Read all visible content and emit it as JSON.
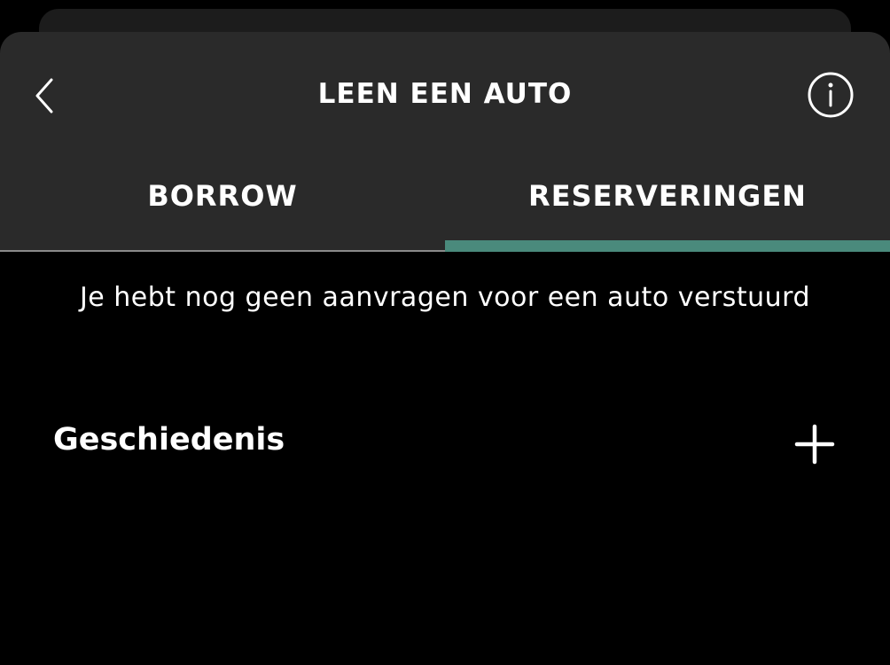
{
  "header": {
    "title": "LEEN EEN AUTO",
    "back_icon": "chevron-left-icon",
    "info_icon": "info-icon"
  },
  "tabs": [
    {
      "label": "BORROW",
      "active": false
    },
    {
      "label": "RESERVERINGEN",
      "active": true
    }
  ],
  "empty_state": {
    "message": "Je hebt nog geen aanvragen voor een auto verstuurd"
  },
  "history": {
    "label": "Geschiedenis",
    "icon": "plus-icon"
  },
  "colors": {
    "background": "#000000",
    "header_background": "#2a2a2a",
    "accent": "#4a8a7c",
    "text": "#ffffff"
  }
}
